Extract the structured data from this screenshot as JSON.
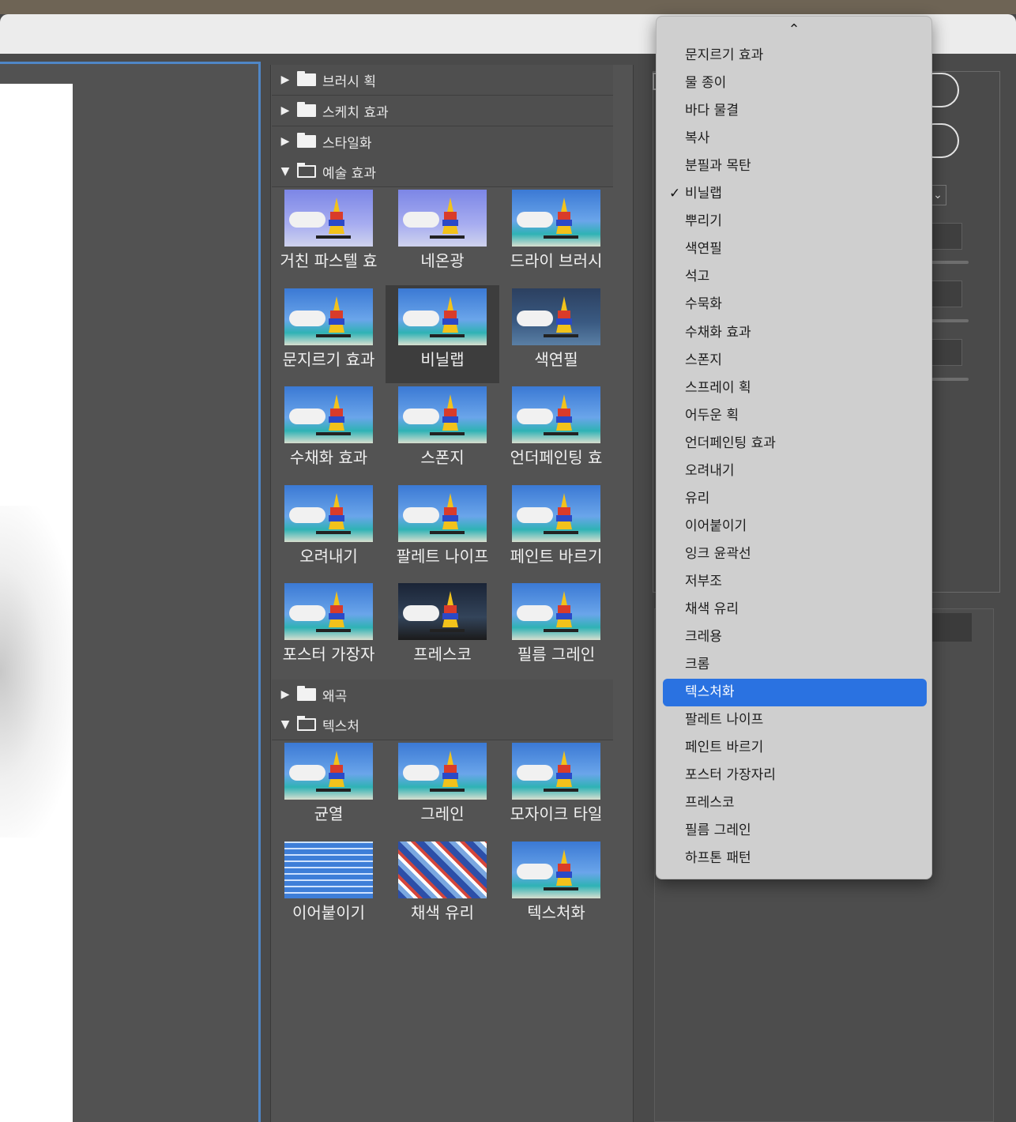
{
  "folders": {
    "brush_strokes": "브러시 획",
    "sketch": "스케치 효과",
    "stylize": "스타일화",
    "artistic": "예술 효과",
    "distort": "왜곡",
    "texture": "텍스처"
  },
  "artistic_filters": [
    {
      "label": "거친 파스텔 효",
      "variant": "v-neon"
    },
    {
      "label": "네온광",
      "variant": "v-neon"
    },
    {
      "label": "드라이 브러시",
      "variant": ""
    },
    {
      "label": "문지르기 효과",
      "variant": ""
    },
    {
      "label": "비닐랩",
      "variant": "",
      "selected": true
    },
    {
      "label": "색연필",
      "variant": "v-dark"
    },
    {
      "label": "수채화 효과",
      "variant": ""
    },
    {
      "label": "스폰지",
      "variant": ""
    },
    {
      "label": "언더페인팅 효",
      "variant": ""
    },
    {
      "label": "오려내기",
      "variant": ""
    },
    {
      "label": "팔레트 나이프",
      "variant": ""
    },
    {
      "label": "페인트 바르기",
      "variant": ""
    },
    {
      "label": "포스터 가장자",
      "variant": ""
    },
    {
      "label": "프레스코",
      "variant": "v-fresco"
    },
    {
      "label": "필름 그레인",
      "variant": ""
    }
  ],
  "texture_filters": [
    {
      "label": "균열",
      "variant": ""
    },
    {
      "label": "그레인",
      "variant": ""
    },
    {
      "label": "모자이크 타일",
      "variant": ""
    },
    {
      "label": "이어붙이기",
      "variant": "v-tile"
    },
    {
      "label": "채색 유리",
      "variant": "v-stained"
    },
    {
      "label": "텍스처화",
      "variant": ""
    }
  ],
  "dropdown": {
    "scroll_up_icon": "chevron-up-icon",
    "checked_item": "비닐랩",
    "highlighted_item": "텍스처화",
    "items": [
      "문지르기 효과",
      "물 종이",
      "바다 물결",
      "복사",
      "분필과 목탄",
      "비닐랩",
      "뿌리기",
      "색연필",
      "석고",
      "수묵화",
      "수채화 효과",
      "스폰지",
      "스프레이 획",
      "어두운 획",
      "언더페인팅 효과",
      "오려내기",
      "유리",
      "이어붙이기",
      "잉크 윤곽선",
      "저부조",
      "채색 유리",
      "크레용",
      "크롬",
      "텍스처화",
      "팔레트 나이프",
      "페인트 바르기",
      "포스터 가장자리",
      "프레스코",
      "필름 그레인",
      "하프톤 패턴"
    ]
  },
  "colors": {
    "highlight": "#2a72e1",
    "panel_border_accent": "#4f86c6"
  }
}
